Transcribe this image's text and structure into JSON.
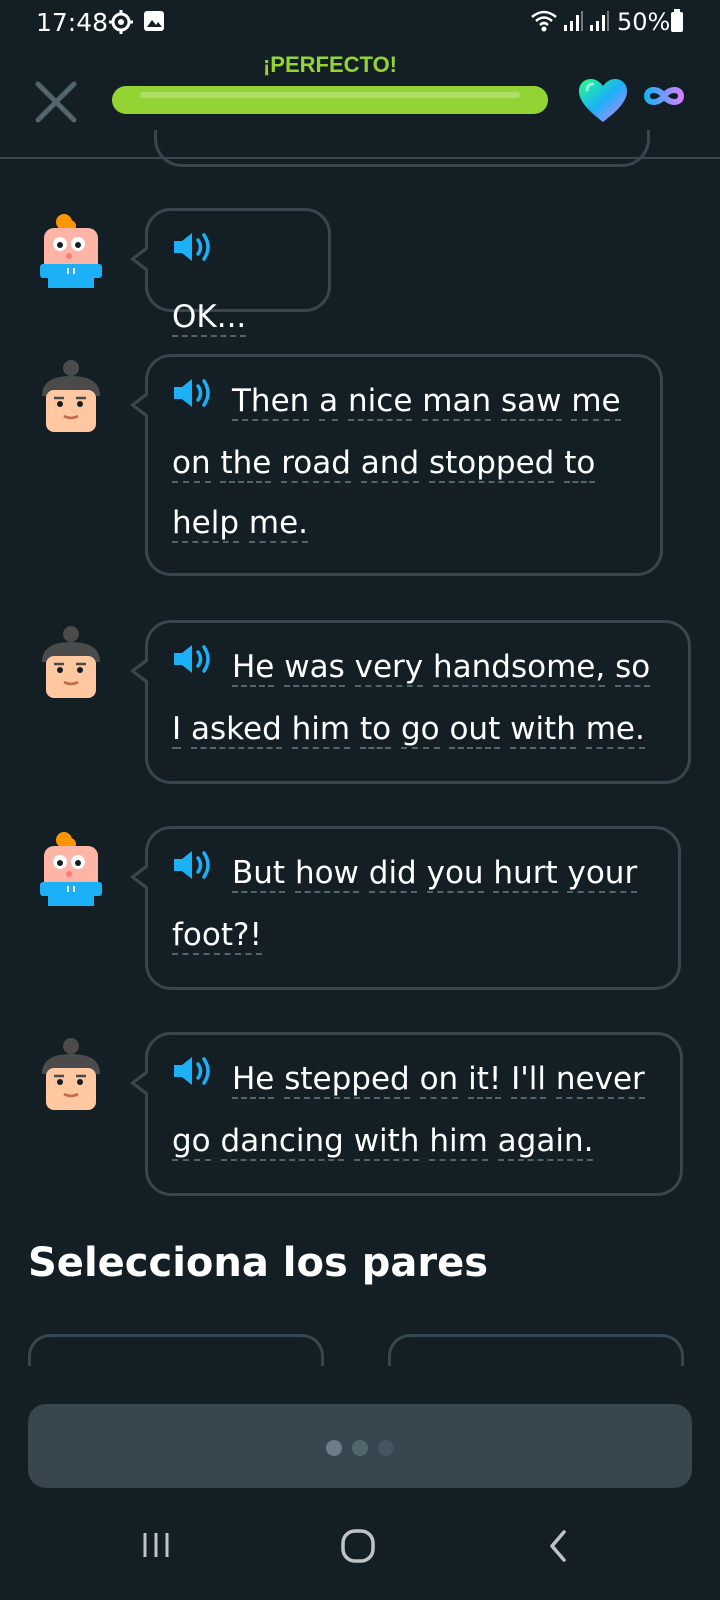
{
  "status_bar": {
    "time": "17:48",
    "battery": "50%",
    "icons": [
      "settings-gear-icon",
      "image-icon",
      "wifi-icon",
      "signal-icon",
      "signal-icon",
      "battery-icon"
    ]
  },
  "header": {
    "close_icon": "close-icon",
    "feedback_label": "¡PERFECTO!",
    "progress": 1.0,
    "hearts_icon": "heart-icon",
    "hearts_count_icon": "infinity-icon"
  },
  "colors": {
    "background": "#131f24",
    "border": "#37464f",
    "green": "#93d333",
    "blue": "#1cb0f6"
  },
  "messages": [
    {
      "speaker": "lily",
      "words": [
        "OK..."
      ]
    },
    {
      "speaker": "oscar",
      "words": [
        "Then",
        "a",
        "nice",
        "man",
        "saw",
        "me",
        "on",
        "the",
        "road",
        "and",
        "stopped",
        "to",
        "help",
        "me."
      ],
      "lines": [
        [
          "Then",
          "a",
          "nice",
          "man",
          "saw",
          "me"
        ],
        [
          "on",
          "the",
          "road",
          "and",
          "stopped",
          "to"
        ],
        [
          "help",
          "me."
        ]
      ]
    },
    {
      "speaker": "oscar",
      "lines": [
        [
          "He",
          "was",
          "very",
          "handsome,",
          "so"
        ],
        [
          "I",
          "asked",
          "him",
          "to",
          "go",
          "out",
          "with",
          "me."
        ]
      ]
    },
    {
      "speaker": "lily",
      "lines": [
        [
          "But",
          "how",
          "did",
          "you",
          "hurt",
          "your"
        ],
        [
          "foot?!"
        ]
      ]
    },
    {
      "speaker": "oscar",
      "lines": [
        [
          "He",
          "stepped",
          "on",
          "it!",
          "I'll",
          "never"
        ],
        [
          "go",
          "dancing",
          "with",
          "him",
          "again."
        ]
      ]
    }
  ],
  "section": {
    "title": "Selecciona los pares"
  },
  "nav": {
    "recent": "recent-apps-icon",
    "home": "home-icon",
    "back": "back-icon"
  }
}
